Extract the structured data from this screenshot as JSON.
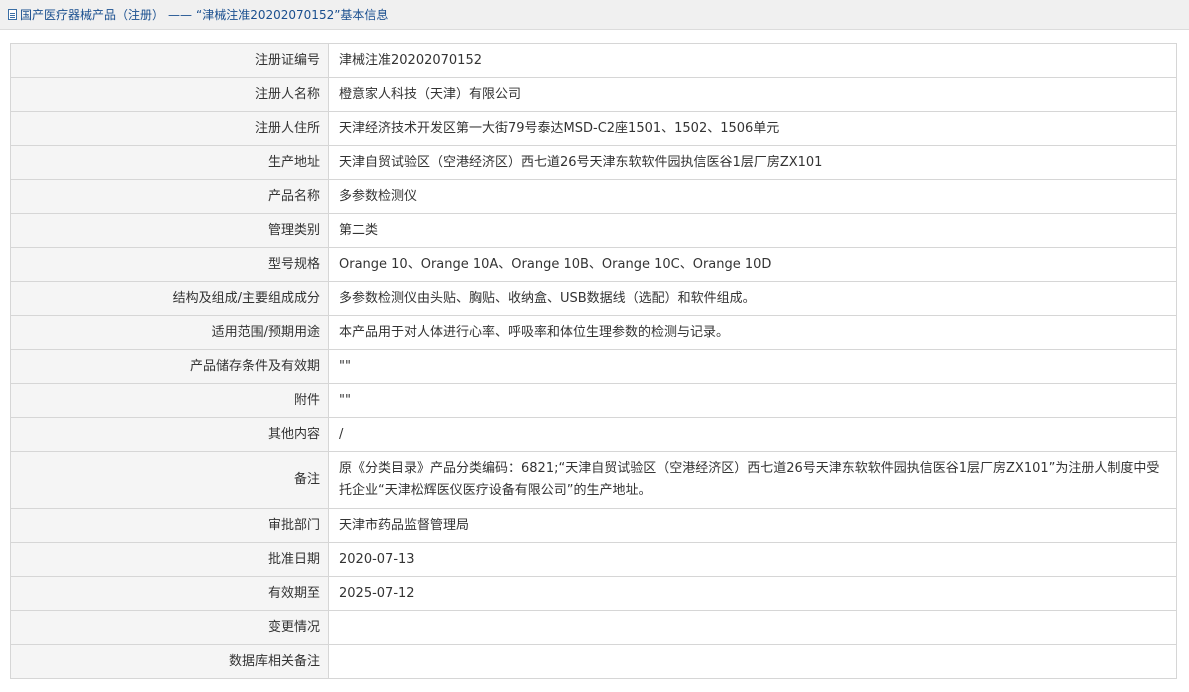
{
  "breadcrumb": {
    "root": "国产医疗器械产品（注册）",
    "separator": "——",
    "current": "“津械注准20202070152”基本信息"
  },
  "rows": [
    {
      "label": "注册证编号",
      "value": "津械注准20202070152"
    },
    {
      "label": "注册人名称",
      "value": "橙意家人科技（天津）有限公司"
    },
    {
      "label": "注册人住所",
      "value": "天津经济技术开发区第一大街79号泰达MSD-C2座1501、1502、1506单元"
    },
    {
      "label": "生产地址",
      "value": "天津自贸试验区（空港经济区）西七道26号天津东软软件园执信医谷1层厂房ZX101"
    },
    {
      "label": "产品名称",
      "value": "多参数检测仪"
    },
    {
      "label": "管理类别",
      "value": "第二类"
    },
    {
      "label": "型号规格",
      "value": "Orange 10、Orange 10A、Orange 10B、Orange 10C、Orange 10D"
    },
    {
      "label": "结构及组成/主要组成成分",
      "value": "多参数检测仪由头贴、胸贴、收纳盒、USB数据线（选配）和软件组成。"
    },
    {
      "label": "适用范围/预期用途",
      "value": "本产品用于对人体进行心率、呼吸率和体位生理参数的检测与记录。"
    },
    {
      "label": "产品储存条件及有效期",
      "value": "\"\""
    },
    {
      "label": "附件",
      "value": "\"\""
    },
    {
      "label": "其他内容",
      "value": "/"
    },
    {
      "label": "备注",
      "value": "原《分类目录》产品分类编码：6821;“天津自贸试验区（空港经济区）西七道26号天津东软软件园执信医谷1层厂房ZX101”为注册人制度中受托企业“天津松辉医仪医疗设备有限公司”的生产地址。"
    },
    {
      "label": "审批部门",
      "value": "天津市药品监督管理局"
    },
    {
      "label": "批准日期",
      "value": "2020-07-13"
    },
    {
      "label": "有效期至",
      "value": "2025-07-12"
    },
    {
      "label": "变更情况",
      "value": ""
    },
    {
      "label": "数据库相关备注",
      "value": ""
    }
  ]
}
